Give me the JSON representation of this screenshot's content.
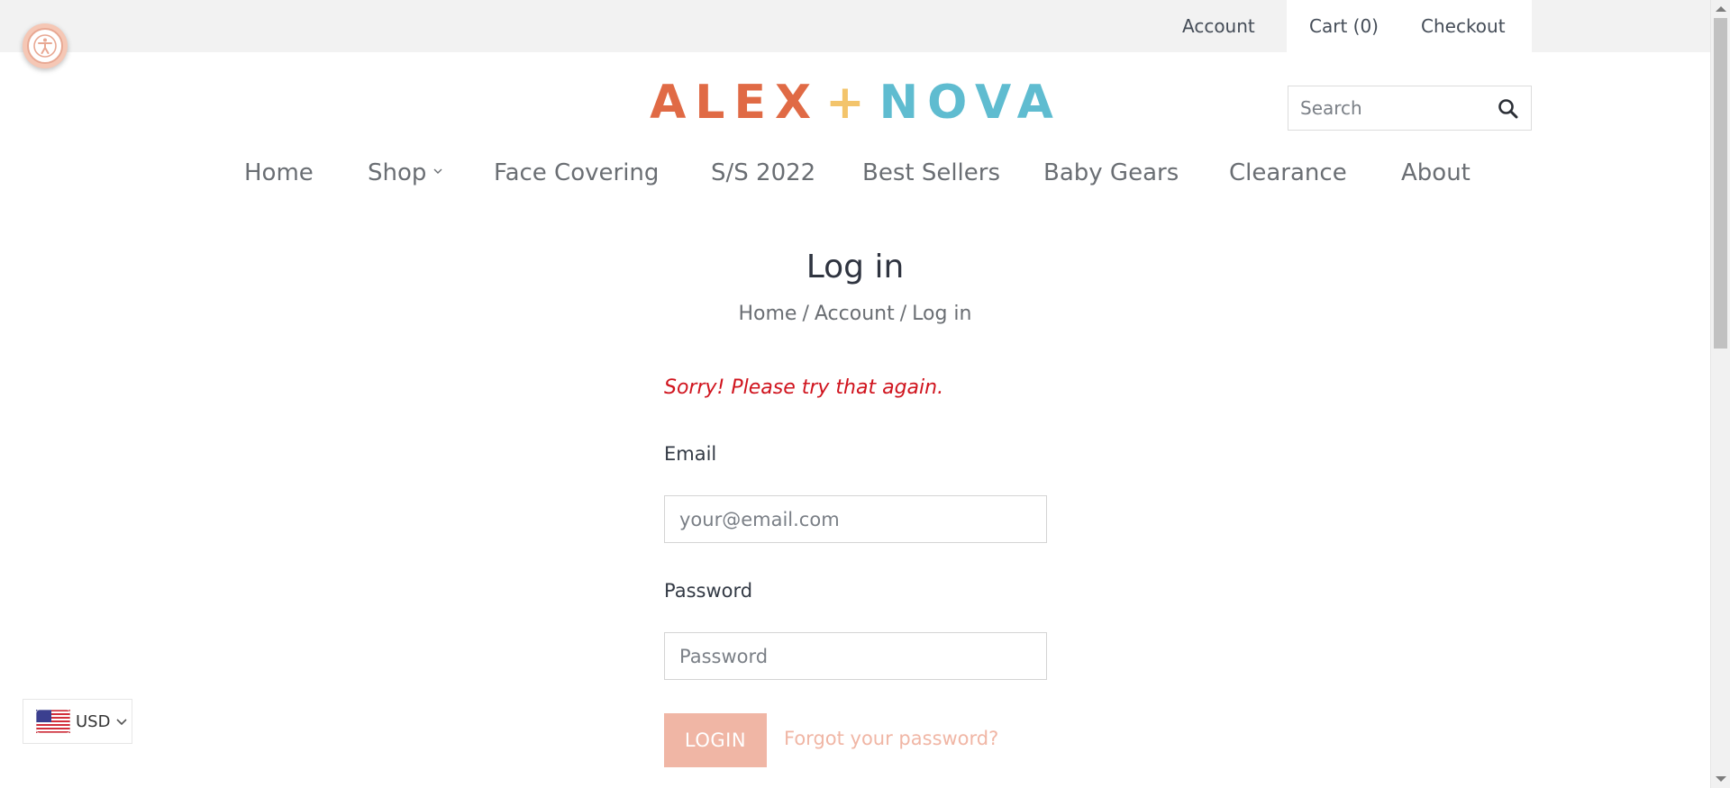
{
  "topbar": {
    "account_label": "Account",
    "cart_label": "Cart (0)",
    "checkout_label": "Checkout"
  },
  "logo": {
    "part1": "ALEX",
    "plus": "+",
    "part2": "NOVA",
    "colors": {
      "alex": "#e06a45",
      "plus": "#f3c46b",
      "nova": "#5fbcd0"
    }
  },
  "search": {
    "placeholder": "Search",
    "icon": "search-icon"
  },
  "nav": {
    "items": [
      {
        "label": "Home"
      },
      {
        "label": "Shop",
        "has_dropdown": true
      },
      {
        "label": "Face Covering"
      },
      {
        "label": "S/S 2022"
      },
      {
        "label": "Best Sellers"
      },
      {
        "label": "Baby Gears"
      },
      {
        "label": "Clearance"
      },
      {
        "label": "About"
      }
    ]
  },
  "page": {
    "title": "Log in",
    "breadcrumb": {
      "home": "Home",
      "separator": "/",
      "account": "Account",
      "current": "Log in"
    }
  },
  "form": {
    "error": "Sorry! Please try that again.",
    "email_label": "Email",
    "email_placeholder": "your@email.com",
    "password_label": "Password",
    "password_placeholder": "Password",
    "login_label": "LOGIN",
    "forgot_label": "Forgot your password?"
  },
  "currency": {
    "code": "USD",
    "flag": "us-flag-icon"
  },
  "accessibility": {
    "icon": "accessibility-icon"
  },
  "colors": {
    "accent": "#f0b6a5",
    "error": "#d0141e",
    "topbar_bg": "#f2f2f2"
  }
}
